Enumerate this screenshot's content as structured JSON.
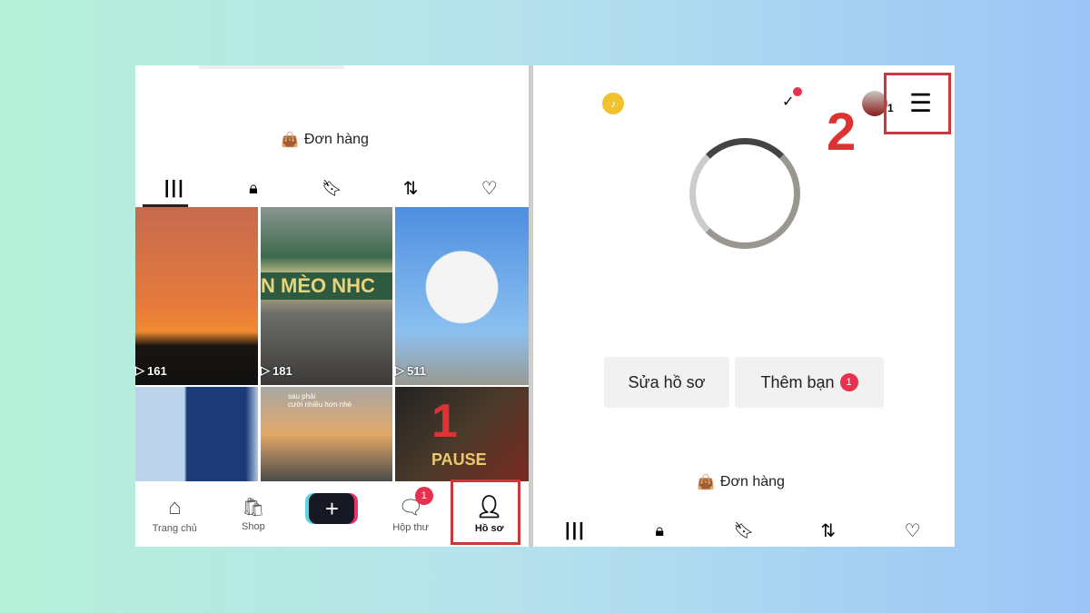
{
  "left": {
    "order_label": "Đơn hàng",
    "tabs": [
      "grid-icon",
      "lock-icon",
      "bookmark-icon",
      "repost-icon",
      "heart-icon"
    ],
    "videos": [
      {
        "views": "161"
      },
      {
        "views": "181",
        "sign_text": "N MÈO NHC"
      },
      {
        "views": "511"
      },
      {
        "views": ""
      },
      {
        "views": "",
        "caption": "sau phải\ncười nhiều hơn nhé"
      },
      {
        "views": "",
        "sign_text": "PAUSE"
      }
    ],
    "nav": {
      "home": "Trang chủ",
      "shop": "Shop",
      "inbox": "Hộp thư",
      "inbox_badge": "1",
      "profile": "Hồ sơ"
    },
    "step_label": "1"
  },
  "right": {
    "edit_profile": "Sửa hồ sơ",
    "add_friends": "Thêm bạn",
    "add_friends_badge": "1",
    "account_badge": "1",
    "order_label": "Đơn hàng",
    "step_label": "2"
  },
  "colors": {
    "highlight": "#c9393c",
    "badge": "#e8304f",
    "accent": "#d33"
  }
}
